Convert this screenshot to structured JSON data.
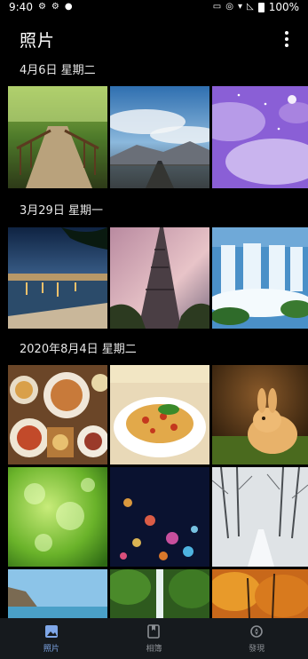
{
  "status_bar": {
    "time": "9:40",
    "battery": "100%"
  },
  "app_bar": {
    "title": "照片"
  },
  "sections": [
    {
      "date": "4月6日 星期二"
    },
    {
      "date": "3月29日 星期一"
    },
    {
      "date": "2020年8月4日 星期二"
    }
  ],
  "photos": [
    "forest-boardwalk-photo",
    "mountain-road-photo",
    "purple-sky-photo",
    "coast-town-night-photo",
    "eiffel-tower-photo",
    "waterfall-photo",
    "food-table-photo",
    "spaghetti-photo",
    "rabbit-photo",
    "green-bokeh-photo",
    "city-lights-bokeh-photo",
    "snowy-road-photo",
    "coast-cliff-photo",
    "jungle-waterfall-photo",
    "autumn-forest-photo"
  ],
  "bottom_nav": {
    "items": [
      {
        "label": "照片",
        "icon": "photos-icon",
        "active": true
      },
      {
        "label": "相簿",
        "icon": "albums-icon",
        "active": false
      },
      {
        "label": "發現",
        "icon": "discover-icon",
        "active": false
      }
    ]
  },
  "colors": {
    "accent": "#7fa7e8",
    "nav_bg": "#161a1e",
    "background": "#000000"
  }
}
